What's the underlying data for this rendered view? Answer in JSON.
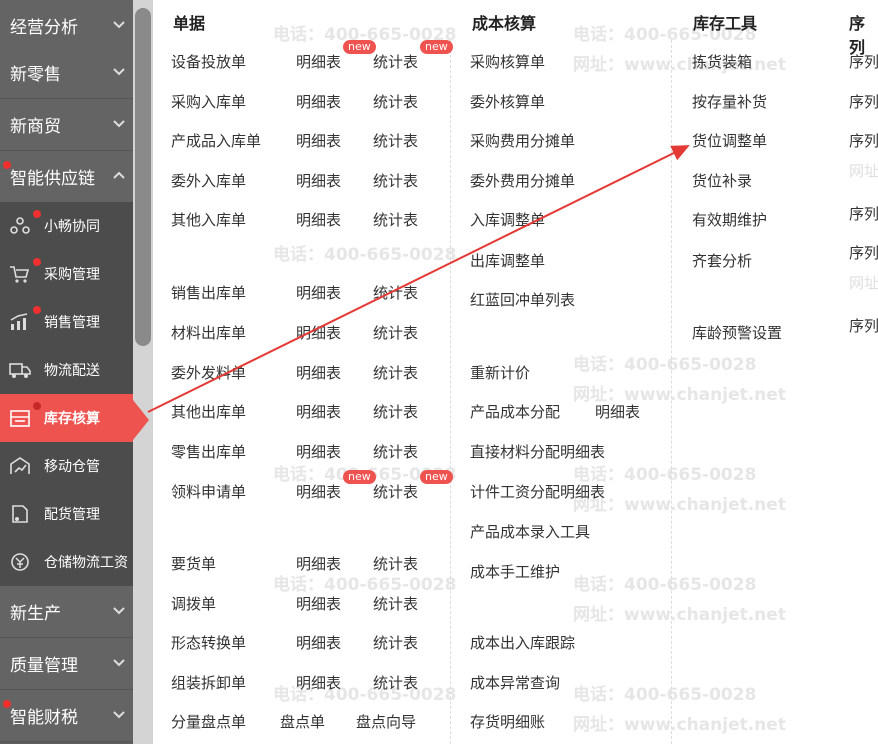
{
  "sidebar": {
    "categories": [
      {
        "label": "经营分析"
      },
      {
        "label": "新零售"
      },
      {
        "label": "新商贸"
      },
      {
        "label": "智能供应链"
      },
      {
        "label": "新生产"
      },
      {
        "label": "质量管理"
      },
      {
        "label": "智能财税"
      }
    ],
    "subitems": [
      {
        "label": "小畅协同",
        "icon": "collaboration-icon"
      },
      {
        "label": "采购管理",
        "icon": "cart-icon"
      },
      {
        "label": "销售管理",
        "icon": "sales-chart-icon"
      },
      {
        "label": "物流配送",
        "icon": "truck-icon"
      },
      {
        "label": "库存核算",
        "icon": "inventory-icon",
        "active": true
      },
      {
        "label": "移动仓管",
        "icon": "mobile-warehouse-icon"
      },
      {
        "label": "配货管理",
        "icon": "distribution-icon"
      },
      {
        "label": "仓储物流工资",
        "icon": "wage-icon"
      }
    ]
  },
  "columns": {
    "documents": {
      "header": "单据",
      "rows": [
        {
          "name": "设备投放单",
          "detail": "明细表",
          "stats": "统计表",
          "detail_badge": "new",
          "stats_badge": "new"
        },
        {
          "name": "采购入库单",
          "detail": "明细表",
          "stats": "统计表"
        },
        {
          "name": "产成品入库单",
          "detail": "明细表",
          "stats": "统计表"
        },
        {
          "name": "委外入库单",
          "detail": "明细表",
          "stats": "统计表"
        },
        {
          "name": "其他入库单",
          "detail": "明细表",
          "stats": "统计表"
        },
        {
          "name": "销售出库单",
          "detail": "明细表",
          "stats": "统计表"
        },
        {
          "name": "材料出库单",
          "detail": "明细表",
          "stats": "统计表"
        },
        {
          "name": "委外发料单",
          "detail": "明细表",
          "stats": "统计表"
        },
        {
          "name": "其他出库单",
          "detail": "明细表",
          "stats": "统计表"
        },
        {
          "name": "零售出库单",
          "detail": "明细表",
          "stats": "统计表"
        },
        {
          "name": "领料申请单",
          "detail": "明细表",
          "stats": "统计表",
          "detail_badge": "new",
          "stats_badge": "new"
        },
        {
          "name": "要货单",
          "detail": "明细表",
          "stats": "统计表"
        },
        {
          "name": "调拨单",
          "detail": "明细表",
          "stats": "统计表"
        },
        {
          "name": "形态转换单",
          "detail": "明细表",
          "stats": "统计表"
        },
        {
          "name": "组装拆卸单",
          "detail": "明细表",
          "stats": "统计表"
        },
        {
          "name": "分量盘点单",
          "detail": "盘点单",
          "stats": "盘点向导"
        }
      ]
    },
    "costing": {
      "header": "成本核算",
      "items": [
        "采购核算单",
        "委外核算单",
        "采购费用分摊单",
        "委外费用分摊单",
        "入库调整单",
        "出库调整单",
        "红蓝回冲单列表",
        "重新计价",
        "产品成本分配",
        "直接材料分配明细表",
        "计件工资分配明细表",
        "产品成本录入工具",
        "成本手工维护",
        "成本出入库跟踪",
        "成本异常查询",
        "存货明细账"
      ],
      "cost_alloc_detail": "明细表"
    },
    "tools": {
      "header": "库存工具",
      "items": [
        "拣货装箱",
        "按存量补货",
        "货位调整单",
        "货位补录",
        "有效期维护",
        "齐套分析",
        "库龄预警设置"
      ]
    },
    "serial": {
      "header": "序列",
      "items": [
        "序列",
        "序列",
        "序列",
        "网址",
        "序列",
        "序列",
        "网址",
        "序列"
      ]
    }
  },
  "watermark": {
    "phone": "电话：400-665-0028",
    "site": "网址：www.chanjet.net"
  },
  "colors": {
    "accent": "#ef5350",
    "sidebar_bg": "#5e5e5e",
    "arrow": "#e53935"
  }
}
